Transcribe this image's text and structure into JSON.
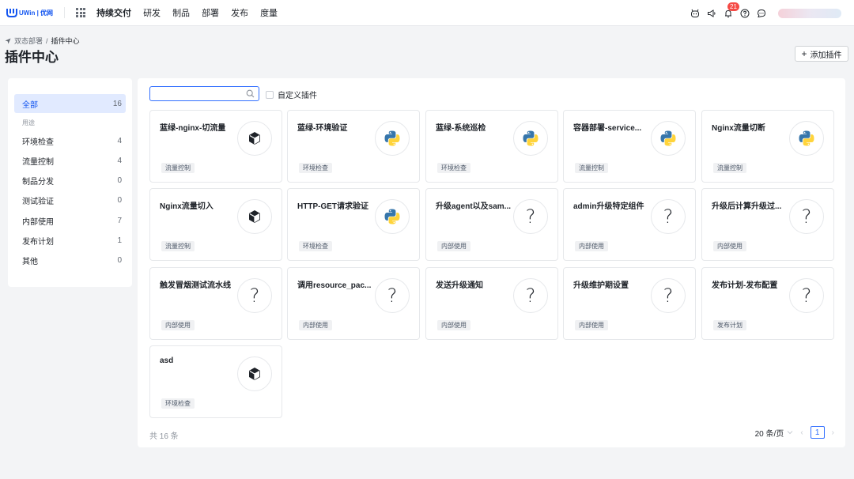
{
  "app": {
    "logo_text": "UWin | 优网",
    "nav": [
      {
        "label": "持续交付",
        "active": true
      },
      {
        "label": "研发",
        "active": false
      },
      {
        "label": "制品",
        "active": false
      },
      {
        "label": "部署",
        "active": false
      },
      {
        "label": "发布",
        "active": false
      },
      {
        "label": "度量",
        "active": false
      }
    ],
    "notification_count": "21",
    "icons": [
      "bot-icon",
      "announcement-icon",
      "bell-icon",
      "help-icon",
      "message-icon"
    ]
  },
  "breadcrumb": {
    "parent": "双态部署",
    "separator": "/",
    "current": "插件中心"
  },
  "page_title": "插件中心",
  "add_plugin_label": "添加插件",
  "sidebar": {
    "all": {
      "label": "全部",
      "count": "16"
    },
    "group_label": "用途",
    "items": [
      {
        "label": "环境检查",
        "count": "4"
      },
      {
        "label": "流量控制",
        "count": "4"
      },
      {
        "label": "制品分发",
        "count": "0"
      },
      {
        "label": "测试验证",
        "count": "0"
      },
      {
        "label": "内部使用",
        "count": "7"
      },
      {
        "label": "发布计划",
        "count": "1"
      },
      {
        "label": "其他",
        "count": "0"
      }
    ]
  },
  "filters": {
    "search_placeholder": "",
    "custom_label": "自定义插件"
  },
  "cards": [
    {
      "title": "蓝绿-nginx-切流量",
      "icon": "cube-icon",
      "tag": "流量控制"
    },
    {
      "title": "蓝绿-环境验证",
      "icon": "python-icon",
      "tag": "环境检查"
    },
    {
      "title": "蓝绿-系统巡检",
      "icon": "python-icon",
      "tag": "环境检查"
    },
    {
      "title": "容器部署-service...",
      "icon": "python-icon",
      "tag": "流量控制"
    },
    {
      "title": "Nginx流量切断",
      "icon": "python-icon",
      "tag": "流量控制"
    },
    {
      "title": "Nginx流量切入",
      "icon": "cube-icon",
      "tag": "流量控制"
    },
    {
      "title": "HTTP-GET请求验证",
      "icon": "python-icon",
      "tag": "环境检查"
    },
    {
      "title": "升级agent以及sam...",
      "icon": "question-icon",
      "tag": "内部使用"
    },
    {
      "title": "admin升级特定组件",
      "icon": "question-icon",
      "tag": "内部使用"
    },
    {
      "title": "升级后计算升级过...",
      "icon": "question-icon",
      "tag": "内部使用"
    },
    {
      "title": "触发冒烟测试流水线",
      "icon": "question-icon",
      "tag": "内部使用"
    },
    {
      "title": "调用resource_pac...",
      "icon": "question-icon",
      "tag": "内部使用"
    },
    {
      "title": "发送升级通知",
      "icon": "question-icon",
      "tag": "内部使用"
    },
    {
      "title": "升级维护期设置",
      "icon": "question-icon",
      "tag": "内部使用"
    },
    {
      "title": "发布计划-发布配置",
      "icon": "question-icon",
      "tag": "发布计划"
    },
    {
      "title": "asd",
      "icon": "cube-icon",
      "tag": "环境检查"
    }
  ],
  "pagination": {
    "total": "共 16 条",
    "page_size": "20 条/页",
    "current_page": "1"
  }
}
